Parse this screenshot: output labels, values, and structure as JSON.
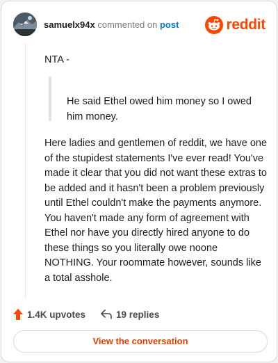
{
  "header": {
    "username": "samuelx94x",
    "commented_text": "commented on",
    "post_link": "post",
    "brand": "reddit"
  },
  "comment": {
    "opening": "NTA -",
    "quote": "He said Ethel owed him money so I owed him money.",
    "paragraph": "Here ladies and gentlemen of reddit, we have one of the stupidest statements I've ever read! You've made it clear that you did not want these extras to be added and it hasn't been a problem previously until Ethel couldn't make the payments anymore. You haven't made any form of agreement with Ethel nor have you directly hired anyone to do these things so you literally owe noone NOTHING. Your roommate however, sounds like a total asshole."
  },
  "actions": {
    "upvotes": "1.4K upvotes",
    "replies": "19 replies",
    "view_button": "View the conversation"
  },
  "colors": {
    "brand": "#ff4500",
    "link": "#0079d3",
    "upvote": "#ff4500"
  },
  "icons": [
    "avatar-image",
    "reddit-snoo-icon",
    "upvote-arrow-icon",
    "reply-arrow-icon"
  ]
}
